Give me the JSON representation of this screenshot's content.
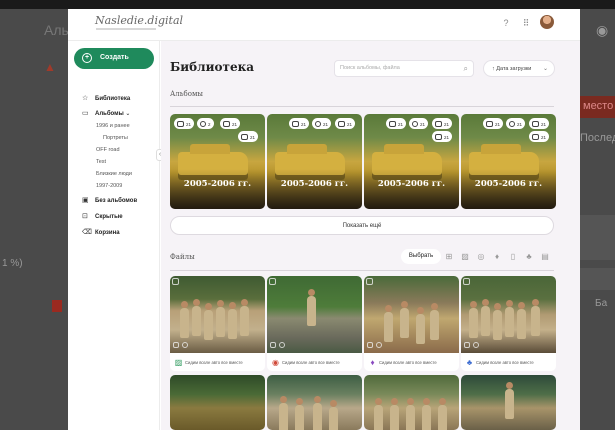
{
  "background": {
    "title_fragment": "Аль",
    "side_right_1": "Послед",
    "side_right_2": "Ба",
    "error_fragment": "место",
    "percent_fragment": "1 %)"
  },
  "header": {
    "logo": "Nasledie.digital",
    "icons": [
      "help-icon",
      "apps-grid-icon",
      "user-avatar"
    ]
  },
  "sidebar": {
    "create_label": "Создать",
    "items": [
      {
        "label": "Библиотека",
        "icon": "star-icon"
      },
      {
        "label": "Альбомы",
        "icon": "folder-icon"
      },
      {
        "label": "Без альбомов",
        "icon": "folder-off-icon"
      },
      {
        "label": "Скрытые",
        "icon": "lock-icon"
      },
      {
        "label": "Корзина",
        "icon": "trash-icon"
      }
    ],
    "subitems": [
      "1996 и ранее",
      "Портреты",
      "OFF road",
      "Test",
      "Близкие люди",
      "1997-2009"
    ]
  },
  "main": {
    "title": "Библиотека",
    "search_placeholder": "Поиск альбомы, файла",
    "sort_label": "Дата загрузки",
    "albums_heading": "Альбомы",
    "files_heading": "Файлы",
    "show_more": "Показать ещё",
    "select_label": "Выбрать",
    "albums": [
      {
        "caption": "2005-2006 гг.",
        "pills": [
          {
            "t": "img",
            "n": "21"
          },
          {
            "t": "mic",
            "n": "2"
          },
          {
            "t": "doc",
            "n": "21"
          },
          {
            "t": "doc",
            "n": "21"
          }
        ]
      },
      {
        "caption": "2005-2006 гг.",
        "pills": [
          {
            "t": "img",
            "n": "21"
          },
          {
            "t": "mic",
            "n": "21"
          },
          {
            "t": "doc",
            "n": "21"
          }
        ]
      },
      {
        "caption": "2005-2006 гг.",
        "pills": [
          {
            "t": "img",
            "n": "21"
          },
          {
            "t": "mic",
            "n": "21"
          },
          {
            "t": "doc",
            "n": "21"
          },
          {
            "t": "doc",
            "n": "21"
          }
        ]
      },
      {
        "caption": "2005-2006 гг.",
        "pills": [
          {
            "t": "img",
            "n": "21"
          },
          {
            "t": "mic",
            "n": "21"
          },
          {
            "t": "doc",
            "n": "21"
          },
          {
            "t": "doc",
            "n": "21"
          }
        ]
      }
    ],
    "file_types": [
      "grid-icon",
      "image-icon",
      "circle-icon",
      "mic-icon",
      "document-icon",
      "people-icon",
      "gallery-icon"
    ],
    "files": [
      {
        "text": "Сидим возле авто все вместе",
        "icon": "image-icon",
        "color": "#2e9a5e",
        "photo": "p1"
      },
      {
        "text": "Сидим возле авто все вместе",
        "icon": "location-icon",
        "color": "#d04a3a",
        "photo": "p2"
      },
      {
        "text": "Сидим возле авто все вместе",
        "icon": "mic-icon",
        "color": "#8a4ac0",
        "photo": "p3"
      },
      {
        "text": "Сидим возле авто все вместе",
        "icon": "people-icon",
        "color": "#3a6ad0",
        "photo": "p4"
      },
      {
        "text": "",
        "icon": "",
        "color": "",
        "photo": "p5"
      },
      {
        "text": "",
        "icon": "",
        "color": "",
        "photo": "p6"
      },
      {
        "text": "",
        "icon": "",
        "color": "",
        "photo": "p7"
      },
      {
        "text": "",
        "icon": "",
        "color": "",
        "photo": "p8"
      }
    ]
  }
}
